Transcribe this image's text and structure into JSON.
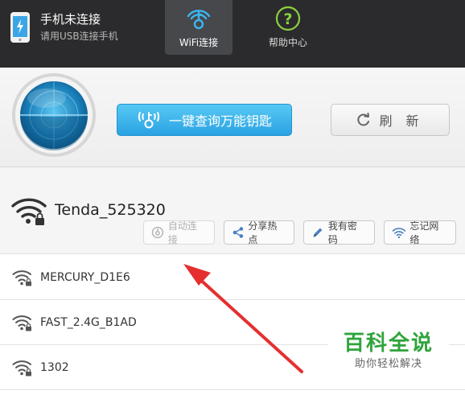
{
  "topbar": {
    "phone_title": "手机未连接",
    "phone_subtitle": "请用USB连接手机",
    "phone_icon": "phone-icon",
    "tabs": [
      {
        "label": "WiFi连接",
        "icon": "wifi-key-icon",
        "active": true
      },
      {
        "label": "帮助中心",
        "icon": "question-icon",
        "active": false
      }
    ]
  },
  "actions": {
    "query_label": "一键查询万能钥匙",
    "refresh_label": "刷 新"
  },
  "current": {
    "ssid": "Tenda_525320",
    "buttons": [
      {
        "label": "自动连接",
        "icon": "wifi-key-icon",
        "enabled": false
      },
      {
        "label": "分享热点",
        "icon": "share-icon",
        "enabled": true
      },
      {
        "label": "我有密码",
        "icon": "pencil-icon",
        "enabled": true
      },
      {
        "label": "忘记网络",
        "icon": "wifi-icon",
        "enabled": true
      }
    ]
  },
  "networks": [
    {
      "name": "MERCURY_D1E6",
      "locked": true
    },
    {
      "name": "FAST_2.4G_B1AD",
      "locked": true
    },
    {
      "name": "1302",
      "locked": true
    }
  ],
  "watermark": {
    "title": "百科全说",
    "subtitle": "助你轻松解决"
  },
  "colors": {
    "topbar": "#2b2b2d",
    "accent_blue": "#2aa3e3",
    "arrow_red": "#e52f2f",
    "watermark_green": "#2fa43c"
  }
}
